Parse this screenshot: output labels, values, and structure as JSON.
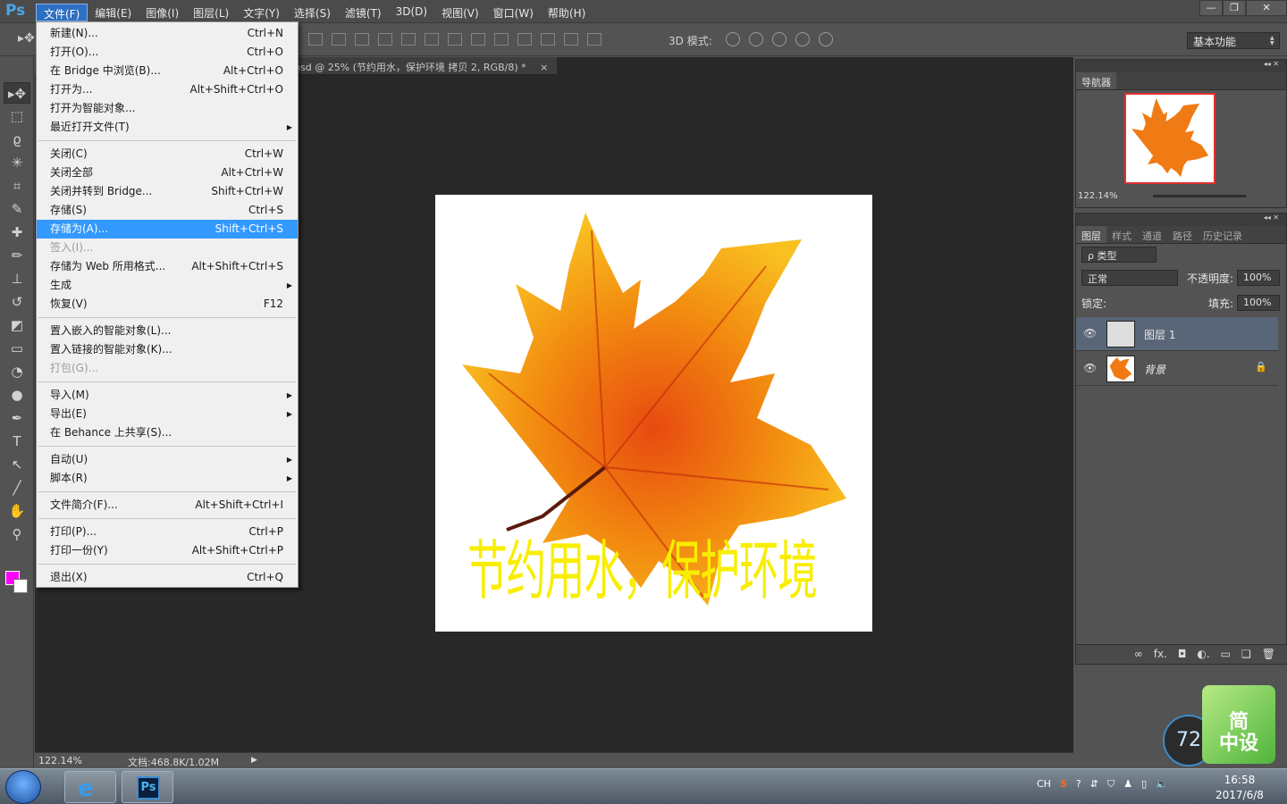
{
  "app": {
    "logo": "Ps"
  },
  "menubar": {
    "items": [
      "文件(F)",
      "编辑(E)",
      "图像(I)",
      "图层(L)",
      "文字(Y)",
      "选择(S)",
      "滤镜(T)",
      "3D(D)",
      "视图(V)",
      "窗口(W)",
      "帮助(H)"
    ],
    "active_index": 0
  },
  "window_controls": {
    "minimize": "—",
    "restore": "❐",
    "close": "✕"
  },
  "options_bar": {
    "tool_icon": "move-tool-icon",
    "mode_3d_label": "3D 模式:",
    "workspace": "基本功能"
  },
  "document": {
    "tab_title": "psd @ 25% (节约用水，保护环境 拷贝 2, RGB/8) *",
    "tab_close": "×",
    "canvas_text": "节约用水，保护环境"
  },
  "status": {
    "zoom": "122.14%",
    "doc_info": "文档:468.8K/1.02M",
    "arrow": "▶"
  },
  "file_menu": {
    "items": [
      {
        "label": "新建(N)...",
        "shortcut": "Ctrl+N"
      },
      {
        "label": "打开(O)...",
        "shortcut": "Ctrl+O"
      },
      {
        "label": "在 Bridge 中浏览(B)...",
        "shortcut": "Alt+Ctrl+O"
      },
      {
        "label": "打开为...",
        "shortcut": "Alt+Shift+Ctrl+O"
      },
      {
        "label": "打开为智能对象...",
        "shortcut": ""
      },
      {
        "label": "最近打开文件(T)",
        "shortcut": "",
        "submenu": true
      },
      {
        "sep": true
      },
      {
        "label": "关闭(C)",
        "shortcut": "Ctrl+W"
      },
      {
        "label": "关闭全部",
        "shortcut": "Alt+Ctrl+W"
      },
      {
        "label": "关闭并转到 Bridge...",
        "shortcut": "Shift+Ctrl+W"
      },
      {
        "label": "存储(S)",
        "shortcut": "Ctrl+S"
      },
      {
        "label": "存储为(A)...",
        "shortcut": "Shift+Ctrl+S",
        "highlighted": true
      },
      {
        "label": "签入(I)...",
        "shortcut": "",
        "disabled": true
      },
      {
        "label": "存储为 Web 所用格式...",
        "shortcut": "Alt+Shift+Ctrl+S"
      },
      {
        "label": "生成",
        "shortcut": "",
        "submenu": true
      },
      {
        "label": "恢复(V)",
        "shortcut": "F12"
      },
      {
        "sep": true
      },
      {
        "label": "置入嵌入的智能对象(L)...",
        "shortcut": ""
      },
      {
        "label": "置入链接的智能对象(K)...",
        "shortcut": ""
      },
      {
        "label": "打包(G)...",
        "shortcut": "",
        "disabled": true
      },
      {
        "sep": true
      },
      {
        "label": "导入(M)",
        "shortcut": "",
        "submenu": true
      },
      {
        "label": "导出(E)",
        "shortcut": "",
        "submenu": true
      },
      {
        "label": "在 Behance 上共享(S)...",
        "shortcut": ""
      },
      {
        "sep": true
      },
      {
        "label": "自动(U)",
        "shortcut": "",
        "submenu": true
      },
      {
        "label": "脚本(R)",
        "shortcut": "",
        "submenu": true
      },
      {
        "sep": true
      },
      {
        "label": "文件简介(F)...",
        "shortcut": "Alt+Shift+Ctrl+I"
      },
      {
        "sep": true
      },
      {
        "label": "打印(P)...",
        "shortcut": "Ctrl+P"
      },
      {
        "label": "打印一份(Y)",
        "shortcut": "Alt+Shift+Ctrl+P"
      },
      {
        "sep": true
      },
      {
        "label": "退出(X)",
        "shortcut": "Ctrl+Q"
      }
    ]
  },
  "navigator": {
    "tab": "导航器",
    "zoom": "122.14%"
  },
  "layers_panel": {
    "tabs": [
      "图层",
      "样式",
      "通道",
      "路径",
      "历史记录"
    ],
    "filter": "ρ 类型",
    "blend_mode": "正常",
    "opacity_label": "不透明度:",
    "opacity": "100%",
    "lock_label": "锁定:",
    "fill_label": "填充:",
    "fill": "100%",
    "layers": [
      {
        "name": "图层 1",
        "selected": true
      },
      {
        "name": "背景",
        "locked": true
      }
    ],
    "bottom_icons": [
      "∞",
      "fx.",
      "◘",
      "◐.",
      "▭",
      "❏",
      "🗑"
    ]
  },
  "widgets": {
    "speed": "72",
    "logo_line1": "简",
    "logo_line2": "中设"
  },
  "taskbar": {
    "tray": [
      "CH",
      "S",
      "?",
      "⇵",
      "⛉",
      "♟",
      "▯",
      "🔈"
    ],
    "time": "16:58",
    "date": "2017/6/8"
  },
  "colors": {
    "accent": "#3399ff",
    "foreground": "#ff00ff",
    "background": "#ffffff",
    "canvas_text": "#f8ee00"
  }
}
